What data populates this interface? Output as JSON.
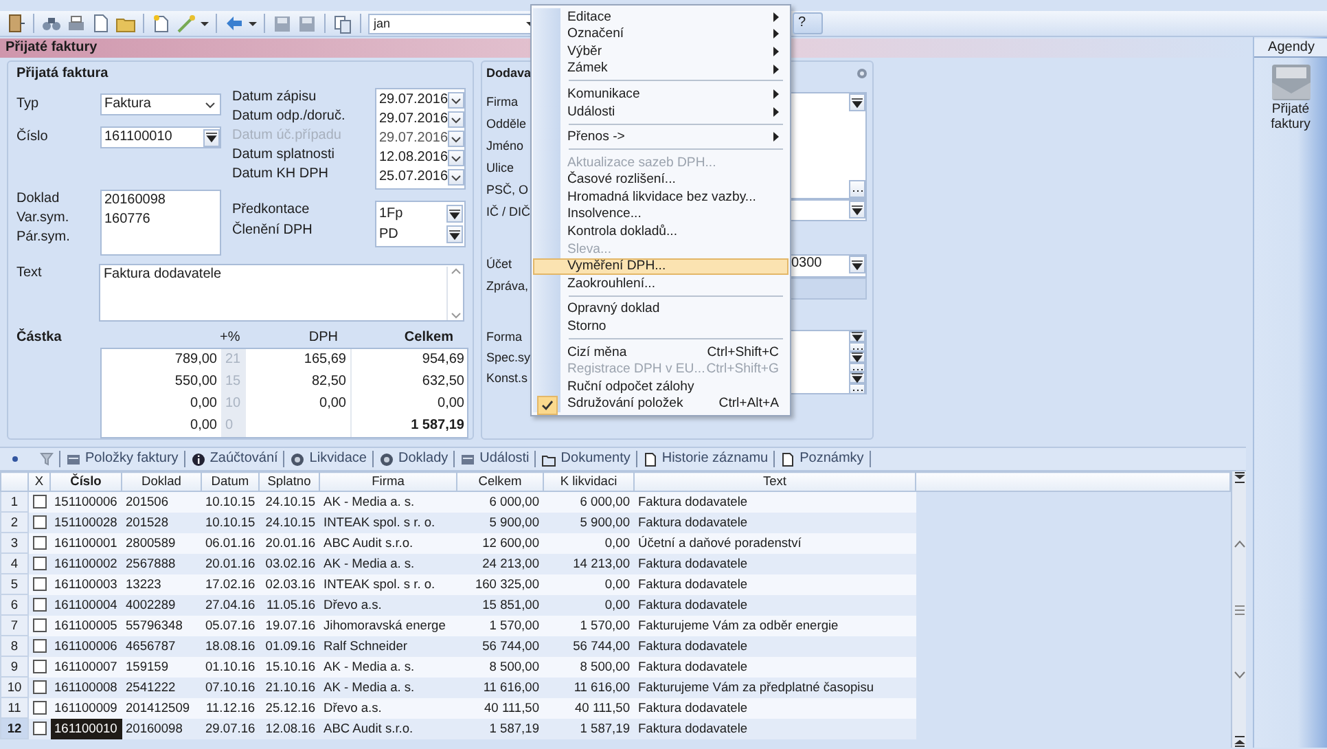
{
  "toolbar": {
    "user_field": "jan",
    "help": "?"
  },
  "title": "Přijaté faktury",
  "invoice": {
    "heading": "Přijatá faktura",
    "type": {
      "label": "Typ",
      "value": "Faktura"
    },
    "number": {
      "label": "Číslo",
      "value": "161100010"
    },
    "refs": [
      {
        "label": "Doklad",
        "value": "20160098"
      },
      {
        "label": "Var.sym.",
        "value": "160776"
      },
      {
        "label": "Pár.sym."
      }
    ],
    "dates": [
      {
        "label": "Datum zápisu",
        "value": "29.07.2016",
        "disabled": false
      },
      {
        "label": "Datum odp./doruč.",
        "value": "29.07.2016",
        "disabled": false
      },
      {
        "label": "Datum úč.případu",
        "value": "29.07.2016",
        "disabled": true
      },
      {
        "label": "Datum splatnosti",
        "value": "12.08.2016",
        "disabled": false
      },
      {
        "label": "Datum KH DPH",
        "value": "25.07.2016",
        "disabled": false
      }
    ],
    "codes": [
      {
        "label": "Předkontace",
        "value": "1Fp"
      },
      {
        "label": "Členění DPH",
        "value": "PD"
      }
    ],
    "text": {
      "label": "Text",
      "value": "Faktura dodavatele"
    },
    "amount": {
      "label": "Částka",
      "headers": [
        "+%",
        "DPH",
        "Celkem"
      ],
      "rows": [
        {
          "kind": "rate",
          "base": "789,00",
          "rate": "21",
          "vat": "165,69",
          "total": "954,69"
        },
        {
          "kind": "rate",
          "base": "550,00",
          "rate": "15",
          "vat": "82,50",
          "total": "632,50"
        },
        {
          "kind": "rate",
          "base": "0,00",
          "rate": "10",
          "vat": "0,00",
          "total": "0,00"
        },
        {
          "kind": "sum",
          "base": "0,00",
          "rate": "0",
          "total": "1 587,19"
        }
      ]
    }
  },
  "supplier": {
    "heading": "Dodava",
    "contact_labels": [
      "Firma",
      "Odděle",
      "Jméno",
      "Ulice",
      "PSČ, O",
      "IČ / DIČ"
    ],
    "payment_labels": [
      "Účet",
      "Zpráva,"
    ],
    "symbol_labels": [
      "Forma",
      "Spec.sy",
      "Konst.s"
    ],
    "account": "0300"
  },
  "menu": [
    {
      "kind": "item",
      "label": "Editace",
      "submenu": true,
      "disabled": false,
      "selected": false,
      "checked": false
    },
    {
      "kind": "item",
      "label": "Označení",
      "submenu": true,
      "disabled": false,
      "selected": false,
      "checked": false
    },
    {
      "kind": "item",
      "label": "Výběr",
      "submenu": true,
      "disabled": false,
      "selected": false,
      "checked": false
    },
    {
      "kind": "item",
      "label": "Zámek",
      "submenu": true,
      "disabled": false,
      "selected": false,
      "checked": false
    },
    {
      "kind": "separator"
    },
    {
      "kind": "item",
      "label": "Komunikace",
      "submenu": true,
      "disabled": false,
      "selected": false,
      "checked": false
    },
    {
      "kind": "item",
      "label": "Události",
      "submenu": true,
      "disabled": false,
      "selected": false,
      "checked": false
    },
    {
      "kind": "separator"
    },
    {
      "kind": "item",
      "label": "Přenos ->",
      "submenu": true,
      "disabled": false,
      "selected": false,
      "checked": false
    },
    {
      "kind": "separator"
    },
    {
      "kind": "item",
      "label": "Aktualizace sazeb DPH...",
      "submenu": false,
      "disabled": true,
      "selected": false,
      "checked": false
    },
    {
      "kind": "item",
      "label": "Časové rozlišení...",
      "submenu": false,
      "disabled": false,
      "selected": false,
      "checked": false
    },
    {
      "kind": "item",
      "label": "Hromadná likvidace bez vazby...",
      "submenu": false,
      "disabled": false,
      "selected": false,
      "checked": false
    },
    {
      "kind": "item",
      "label": "Insolvence...",
      "submenu": false,
      "disabled": false,
      "selected": false,
      "checked": false
    },
    {
      "kind": "item",
      "label": "Kontrola dokladů...",
      "submenu": false,
      "disabled": false,
      "selected": false,
      "checked": false
    },
    {
      "kind": "item",
      "label": "Sleva...",
      "submenu": false,
      "disabled": true,
      "selected": false,
      "checked": false
    },
    {
      "kind": "item",
      "label": "Vyměření DPH...",
      "submenu": false,
      "disabled": false,
      "selected": true,
      "checked": false
    },
    {
      "kind": "item",
      "label": "Zaokrouhlení...",
      "submenu": false,
      "disabled": false,
      "selected": false,
      "checked": false
    },
    {
      "kind": "separator"
    },
    {
      "kind": "item",
      "label": "Opravný doklad",
      "submenu": false,
      "disabled": false,
      "selected": false,
      "checked": false
    },
    {
      "kind": "item",
      "label": "Storno",
      "submenu": false,
      "disabled": false,
      "selected": false,
      "checked": false
    },
    {
      "kind": "separator"
    },
    {
      "kind": "item",
      "label": "Cizí měna",
      "shortcut": "Ctrl+Shift+C",
      "submenu": false,
      "disabled": false,
      "selected": false,
      "checked": false
    },
    {
      "kind": "item",
      "label": "Registrace DPH v EU...",
      "shortcut": "Ctrl+Shift+G",
      "submenu": false,
      "disabled": true,
      "selected": false,
      "checked": false
    },
    {
      "kind": "item",
      "label": "Ruční odpočet zálohy",
      "submenu": false,
      "disabled": false,
      "selected": false,
      "checked": false
    },
    {
      "kind": "item",
      "label": "Sdružování položek",
      "shortcut": "Ctrl+Alt+A",
      "submenu": false,
      "disabled": false,
      "selected": false,
      "checked": true
    }
  ],
  "tabs": [
    {
      "kind": "grid",
      "label": "Položky faktury",
      "selected": false
    },
    {
      "kind": "info",
      "label": "Zaúčtování",
      "selected": false
    },
    {
      "kind": "circle",
      "label": "Likvidace",
      "selected": false
    },
    {
      "kind": "circle",
      "label": "Doklady",
      "selected": false
    },
    {
      "kind": "grid",
      "label": "Události",
      "selected": false
    },
    {
      "kind": "folder",
      "label": "Dokumenty",
      "selected": false
    },
    {
      "kind": "page",
      "label": "Historie záznamu",
      "selected": false
    },
    {
      "kind": "page",
      "label": "Poznámky",
      "selected": false
    }
  ],
  "table": {
    "check_column": "X",
    "columns": [
      "Číslo",
      "Doklad",
      "Datum",
      "Splatno",
      "Firma",
      "Celkem",
      "K likvidaci",
      "Text"
    ],
    "rows": [
      {
        "number": "1",
        "checked": false,
        "selected": false,
        "cells": [
          "151100006",
          "201506",
          "10.10.15",
          "24.10.15",
          "AK - Media a. s.",
          "6 000,00",
          "6 000,00",
          "Faktura dodavatele"
        ]
      },
      {
        "number": "2",
        "checked": false,
        "selected": false,
        "cells": [
          "151100028",
          "201528",
          "10.10.15",
          "24.10.15",
          "INTEAK spol. s r. o.",
          "5 900,00",
          "5 900,00",
          "Faktura dodavatele"
        ]
      },
      {
        "number": "3",
        "checked": false,
        "selected": false,
        "cells": [
          "161100001",
          "2800589",
          "06.01.16",
          "20.01.16",
          "ABC Audit s.r.o.",
          "12 600,00",
          "0,00",
          "Účetní a daňové poradenství"
        ]
      },
      {
        "number": "4",
        "checked": false,
        "selected": false,
        "cells": [
          "161100002",
          "2567888",
          "20.01.16",
          "03.02.16",
          "AK - Media a. s.",
          "24 213,00",
          "14 213,00",
          "Faktura dodavatele"
        ]
      },
      {
        "number": "5",
        "checked": false,
        "selected": false,
        "cells": [
          "161100003",
          "13223",
          "17.02.16",
          "02.03.16",
          "INTEAK spol. s r. o.",
          "160 325,00",
          "0,00",
          "Faktura dodavatele"
        ]
      },
      {
        "number": "6",
        "checked": false,
        "selected": false,
        "cells": [
          "161100004",
          "4002289",
          "27.04.16",
          "11.05.16",
          "Dřevo a.s.",
          "15 851,00",
          "0,00",
          "Faktura dodavatele"
        ]
      },
      {
        "number": "7",
        "checked": false,
        "selected": false,
        "cells": [
          "161100005",
          "55796348",
          "05.07.16",
          "19.07.16",
          "Jihomoravská energe",
          "1 570,00",
          "1 570,00",
          "Fakturujeme Vám za odběr energie"
        ]
      },
      {
        "number": "8",
        "checked": false,
        "selected": false,
        "cells": [
          "161100006",
          "4656787",
          "18.08.16",
          "01.09.16",
          "Ralf Schneider",
          "56 744,00",
          "56 744,00",
          "Faktura dodavatele"
        ]
      },
      {
        "number": "9",
        "checked": false,
        "selected": false,
        "cells": [
          "161100007",
          "159159",
          "01.10.16",
          "15.10.16",
          "AK - Media a. s.",
          "8 500,00",
          "8 500,00",
          "Faktura dodavatele"
        ]
      },
      {
        "number": "10",
        "checked": false,
        "selected": false,
        "cells": [
          "161100008",
          "2541222",
          "07.10.16",
          "21.10.16",
          "AK - Media a. s.",
          "11 616,00",
          "11 616,00",
          "Fakturujeme Vám za předplatné časopisu"
        ]
      },
      {
        "number": "11",
        "checked": false,
        "selected": false,
        "cells": [
          "161100009",
          "201412509",
          "11.12.16",
          "25.12.16",
          "Dřevo a.s.",
          "40 111,50",
          "40 111,50",
          "Faktura dodavatele"
        ]
      },
      {
        "number": "12",
        "checked": false,
        "selected": true,
        "cells": [
          "161100010",
          "20160098",
          "29.07.16",
          "12.08.16",
          "ABC Audit s.r.o.",
          "1 587,19",
          "1 587,19",
          "Faktura dodavatele"
        ]
      }
    ]
  },
  "sidebar": {
    "title": "Agendy",
    "item": "Přijaté faktury"
  }
}
